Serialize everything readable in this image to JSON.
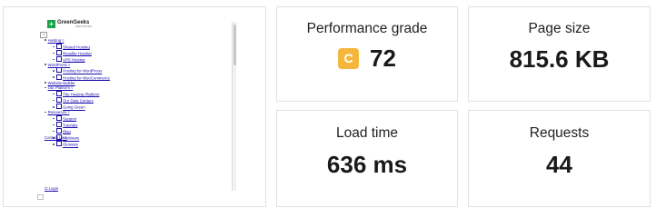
{
  "thumbnail": {
    "logo_text": "GreenGeeks",
    "logo_sub": "WEB HOSTING",
    "menu_button": "≡",
    "nav": [
      {
        "label": "Hosting ▿",
        "children": [
          "Shared Hosting",
          "Reseller Hosting",
          "VPS Hosting"
        ]
      },
      {
        "label": "WordPress ▿",
        "children": [
          "Hosting for WordPress",
          "Hosting for WooCommerce"
        ]
      },
      {
        "label": "Website Builder",
        "children": []
      },
      {
        "label": "Our Platform ▿",
        "children": [
          "The Hosting Platform",
          "Our Data Centers",
          "Going Green"
        ]
      },
      {
        "label": "Resources ▿",
        "children": [
          "Support",
          "Tutorials",
          "Blog",
          "Webinars",
          "Glossary"
        ]
      }
    ],
    "contact": "Contact Us ▿",
    "login": "⏻ Login"
  },
  "metrics": {
    "grade": {
      "label": "Performance grade",
      "letter": "C",
      "score": "72",
      "badge_color": "#f4b73d"
    },
    "page_size": {
      "label": "Page size",
      "value": "815.6 KB"
    },
    "load_time": {
      "label": "Load time",
      "value": "636 ms"
    },
    "requests": {
      "label": "Requests",
      "value": "44"
    }
  }
}
